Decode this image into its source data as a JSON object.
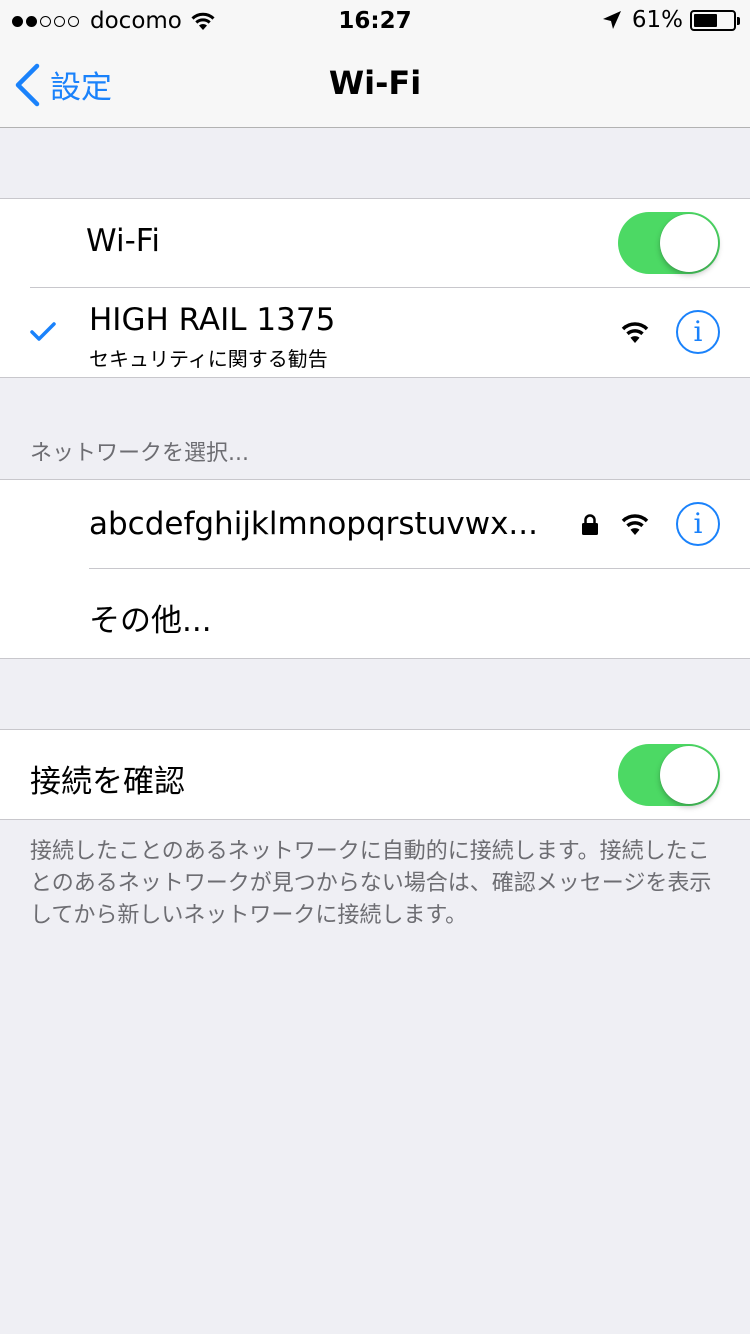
{
  "status_bar": {
    "carrier": "docomo",
    "time": "16:27",
    "battery_percent": "61%",
    "battery_level": 0.61,
    "signal_bars_filled": 2,
    "signal_bars_total": 5
  },
  "nav": {
    "back_label": "設定",
    "title": "Wi-Fi"
  },
  "wifi_section": {
    "toggle_label": "Wi-Fi",
    "toggle_on": true,
    "connected_network": {
      "name": "HIGH RAIL 1375",
      "subtitle": "セキュリティに関する勧告"
    }
  },
  "choose_network": {
    "header": "ネットワークを選択...",
    "networks": [
      {
        "name": "abcdefghijklmnopqrstuvwx...",
        "secured": true
      }
    ],
    "other_label": "その他..."
  },
  "ask_to_join": {
    "label": "接続を確認",
    "toggle_on": true,
    "footer": "接続したことのあるネットワークに自動的に接続します。接続したことのあるネットワークが見つからない場合は、確認メッセージを表示してから新しいネットワークに接続します。"
  },
  "colors": {
    "accent": "#1a82fb",
    "toggle_on": "#4cd964",
    "background": "#efeff4"
  },
  "icons": {
    "back": "chevron-left-icon",
    "location": "location-arrow-icon",
    "wifi": "wifi-icon",
    "lock": "lock-icon",
    "info": "info-icon",
    "check": "checkmark-icon"
  }
}
